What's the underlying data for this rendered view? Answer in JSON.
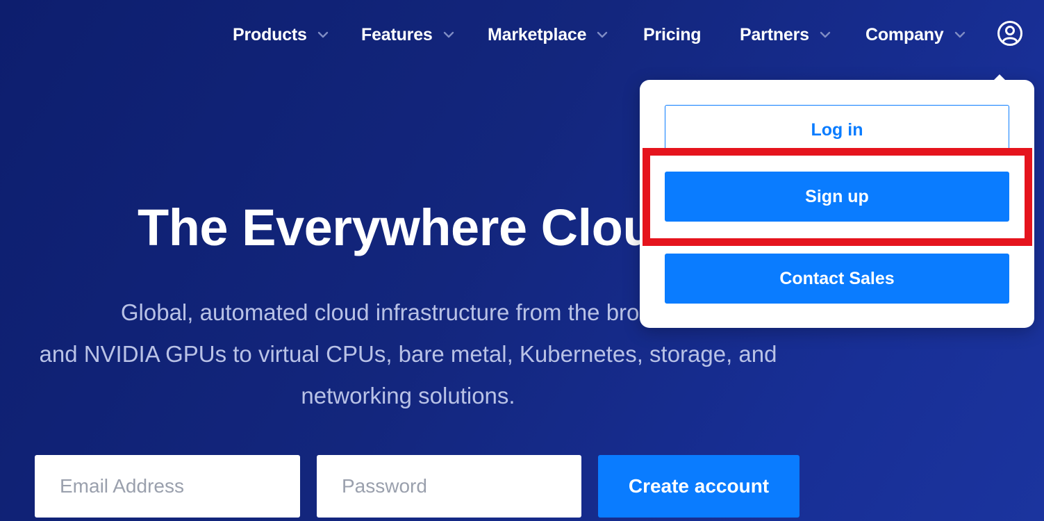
{
  "nav": {
    "items": [
      {
        "label": "Products",
        "has_dropdown": true
      },
      {
        "label": "Features",
        "has_dropdown": true
      },
      {
        "label": "Marketplace",
        "has_dropdown": true
      },
      {
        "label": "Pricing",
        "has_dropdown": false
      },
      {
        "label": "Partners",
        "has_dropdown": true
      },
      {
        "label": "Company",
        "has_dropdown": true
      }
    ],
    "user_icon": "user-circle-icon",
    "chevron_icon": "chevron-down-icon",
    "chevron_color": "#7f8cc4"
  },
  "hero": {
    "title": "The Everywhere Clou",
    "subtitle_line1": "Global, automated cloud infrastructure from the broadest",
    "subtitle_line2": "and NVIDIA GPUs to virtual CPUs, bare metal, Kubernetes, storage, and",
    "subtitle_line3": "networking solutions."
  },
  "signup_form": {
    "email_placeholder": "Email Address",
    "email_value": "",
    "password_placeholder": "Password",
    "password_value": "",
    "submit_label": "Create account"
  },
  "account_menu": {
    "login_label": "Log in",
    "signup_label": "Sign up",
    "contact_label": "Contact Sales"
  },
  "colors": {
    "background": "#13267d",
    "accent": "#0a7cff",
    "highlight": "#e5141d",
    "subtitle_text": "#b9c2e6"
  }
}
